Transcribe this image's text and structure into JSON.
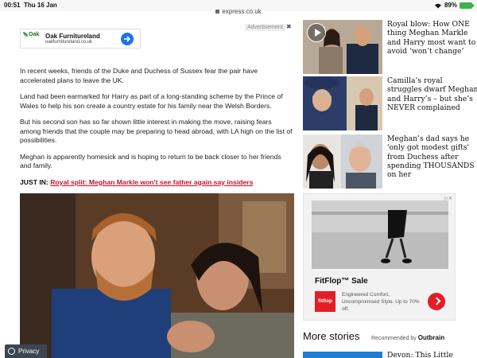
{
  "status": {
    "time": "00:51",
    "date": "Thu 16 Jan",
    "battery": "89%"
  },
  "browser": {
    "url": "express.co.uk"
  },
  "ad_banner": {
    "logo_text": "Oak",
    "name": "Oak Furnitureland",
    "domain": "oakfurnitureland.co.uk",
    "advert_label": "Advertisement",
    "close": "✖"
  },
  "article": {
    "paragraphs": [
      "In recent weeks, friends of the Duke and Duchess of Sussex fear the pair have accelerated plans to leave the UK.",
      "Land had been earmarked for Harry as part of a long-standing scheme by the Prince of Wales to help his son create a country estate for his family near the Welsh Borders.",
      "But his second son has so far shown little interest in making the move, raising fears among friends that the couple may be preparing to head abroad, with LA high on the list of possibilities.",
      "Meghan is apparently homesick and is hoping to return to be back closer to her friends and family."
    ],
    "just_in_label": "JUST IN:",
    "just_in_link": "Royal split: Meghan Markle won't see father again say insiders"
  },
  "sidebar": {
    "stories": [
      {
        "headline": "Royal blow: How ONE thing Meghan Markle and Harry most want to avoid ‘won’t change’"
      },
      {
        "headline": "Camilla’s royal struggles dwarf Meghan and Harry’s – but she’s NEVER complained"
      },
      {
        "headline": "Meghan’s dad says he 'only got modest gifts' from Duchess after spending THOUSANDS on her"
      }
    ],
    "ad": {
      "title": "FitFlop™ Sale",
      "brand": "fitflop",
      "text": "Engineered Comfort, Uncompromised Style. Up to 70% off."
    },
    "more_stories": "More stories",
    "recommended_by": "Recommended by",
    "recommended_brand": "Outbrain",
    "next_headline": "Devon: This Little"
  },
  "privacy_label": "Privacy",
  "colors": {
    "accent_red": "#c8102e",
    "ad_red": "#e41e26",
    "outbrain_blue": "#1c7ed6"
  }
}
